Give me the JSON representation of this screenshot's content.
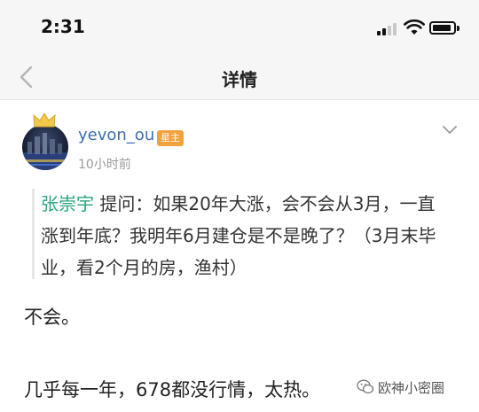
{
  "status_bar": {
    "time": "2:31",
    "signal_bars_active": 2,
    "battery_level": 0.9
  },
  "nav": {
    "title": "详情",
    "back_icon": "chevron-left-icon"
  },
  "post": {
    "author": "yevon_ou",
    "badge": "星主",
    "time_ago": "10小时前",
    "more_icon": "chevron-down-icon",
    "quote": {
      "mention": "张崇宇",
      "text": " 提问：如果20年大涨，会不会从3月，一直涨到年底？我明年6月建仓是不是晚了？（3月末毕业，看2个月的房，渔村）"
    },
    "answer_lines": [
      "不会。",
      "几乎每一年，678都没行情，太热。"
    ]
  },
  "watermark": {
    "text": "欧神小密圈",
    "icon": "wechat-icon"
  },
  "colors": {
    "accent_green": "#25a37f",
    "username_blue": "#3a6fb0",
    "badge_orange": "#f2a23c"
  }
}
